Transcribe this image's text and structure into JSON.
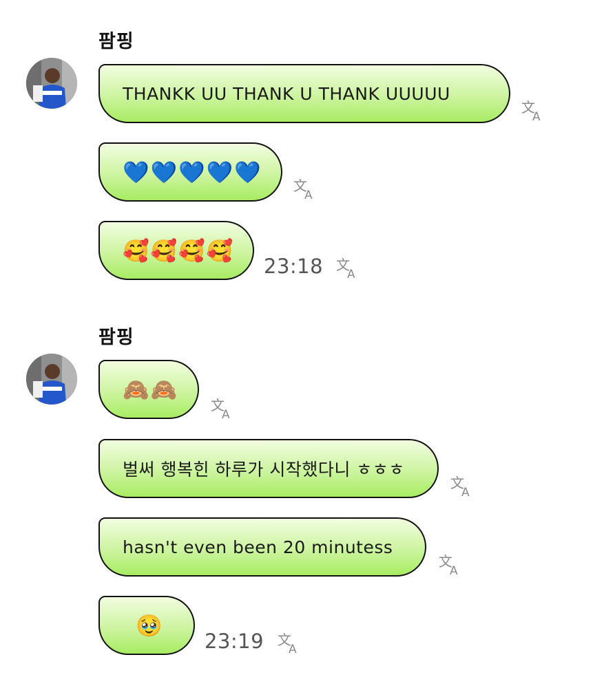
{
  "groups": [
    {
      "sender": "팜핑",
      "messages": [
        {
          "text": "THANKK UU THANK U THANK UUUUU"
        },
        {
          "text": "💙💙💙💙💙"
        },
        {
          "text": "🥰🥰🥰🥰",
          "time": "23:18"
        }
      ]
    },
    {
      "sender": "팜핑",
      "messages": [
        {
          "text": "🙈🙈"
        },
        {
          "text": "벌써 행복힌 하루가 시작했다니 ㅎㅎㅎ"
        },
        {
          "text": "hasn't even been 20 minutess"
        },
        {
          "text": "🥹",
          "time": "23:19"
        }
      ]
    }
  ],
  "icons": {
    "translate": "translate-icon",
    "avatar": "avatar"
  },
  "colors": {
    "bubble_top": "#f2fde0",
    "bubble_bottom": "#a8ec62",
    "bubble_border": "#111111",
    "timestamp": "#555555",
    "translate_icon": "#8a8a8a"
  }
}
